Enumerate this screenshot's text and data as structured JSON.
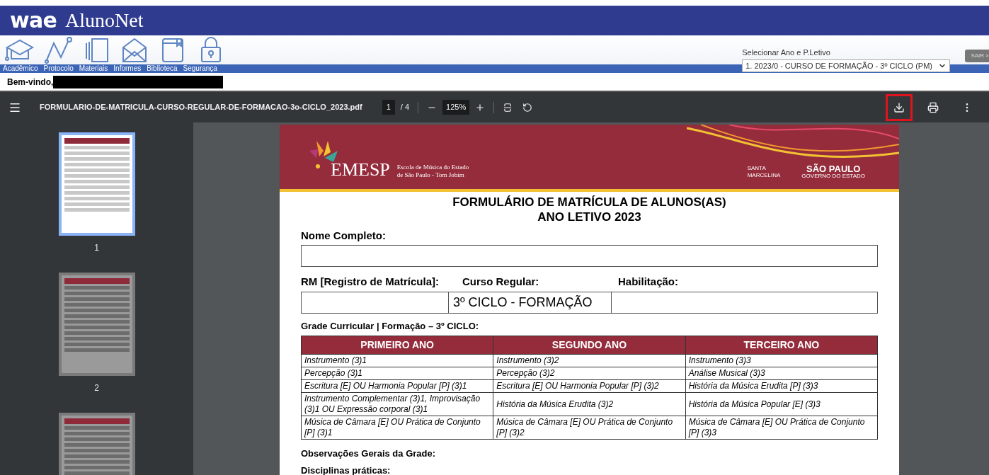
{
  "header": {
    "logo": "wae",
    "title": "AlunoNet"
  },
  "nav": [
    {
      "label": "Acadêmico"
    },
    {
      "label": "Protocolo"
    },
    {
      "label": "Materiais"
    },
    {
      "label": "Informes"
    },
    {
      "label": "Biblioteca"
    },
    {
      "label": "Segurança"
    }
  ],
  "period_select": {
    "label": "Selecionar Ano e P.Letivo",
    "value": "1. 2023/0 - CURSO DE FORMAÇÃO - 3º CICLO (PM)"
  },
  "logout_button": "SAIR ×",
  "welcome": "Bem-vindo,",
  "pdf_toolbar": {
    "filename": "FORMULARIO-DE-MATRICULA-CURSO-REGULAR-DE-FORMACAO-3o-CICLO_2023.pdf",
    "page": "1",
    "page_total": "/ 4",
    "zoom": "125%",
    "actions": [
      {
        "kind": "download",
        "highlighted": true
      },
      {
        "kind": "print",
        "highlighted": false
      },
      {
        "kind": "more",
        "highlighted": false
      }
    ]
  },
  "thumbnails": [
    {
      "label": "1",
      "selected": true
    },
    {
      "label": "2",
      "selected": false
    },
    {
      "selected": false
    }
  ],
  "document": {
    "logo": "EMESP",
    "org_name": [
      "Escola de Música do Estado",
      "de São Paulo - Tom Jobim"
    ],
    "partner_1": [
      "SANTA",
      "MARCELINA"
    ],
    "partner_2": [
      "SÃO PAULO",
      "GOVERNO DO ESTADO"
    ],
    "title": [
      "FORMULÁRIO DE MATRÍCULA DE ALUNOS(AS)",
      "ANO LETIVO 2023"
    ],
    "name_label": "Nome Completo:",
    "rm_label": "RM [Registro de Matrícula]:",
    "course_label": "Curso Regular:",
    "qualification_label": "Habilitação:",
    "course_value": "3º CICLO - FORMAÇÃO",
    "grade_title": "Grade Curricular | Formação – 3º CICLO:",
    "table": {
      "columns": [
        "PRIMEIRO ANO",
        "SEGUNDO ANO",
        "TERCEIRO ANO"
      ],
      "rows": [
        [
          "Instrumento (3)1",
          "Instrumento (3)2",
          "Instrumento (3)3"
        ],
        [
          "Percepção (3)1",
          "Percepção (3)2",
          "Análise Musical (3)3"
        ],
        [
          "Escritura [E] OU Harmonia Popular [P] (3)1",
          "Escritura [E] OU Harmonia Popular [P] (3)2",
          "História da Música Erudita [P] (3)3"
        ],
        [
          "Instrumento Complementar (3)1, Improvisação (3)1 OU Expressão corporal (3)1",
          "História da Música Erudita (3)2",
          "História da Música Popular [E] (3)3"
        ],
        [
          "Música de Câmara [E] OU Prática de Conjunto [P] (3)1",
          "Música de Câmara [E] OU Prática de Conjunto [P] (3)2",
          "Música de Câmara [E] OU Prática de Conjunto [P] (3)3"
        ]
      ]
    },
    "notes_title": "Observações Gerais da Grade:",
    "practical_title": "Disciplinas práticas:"
  }
}
